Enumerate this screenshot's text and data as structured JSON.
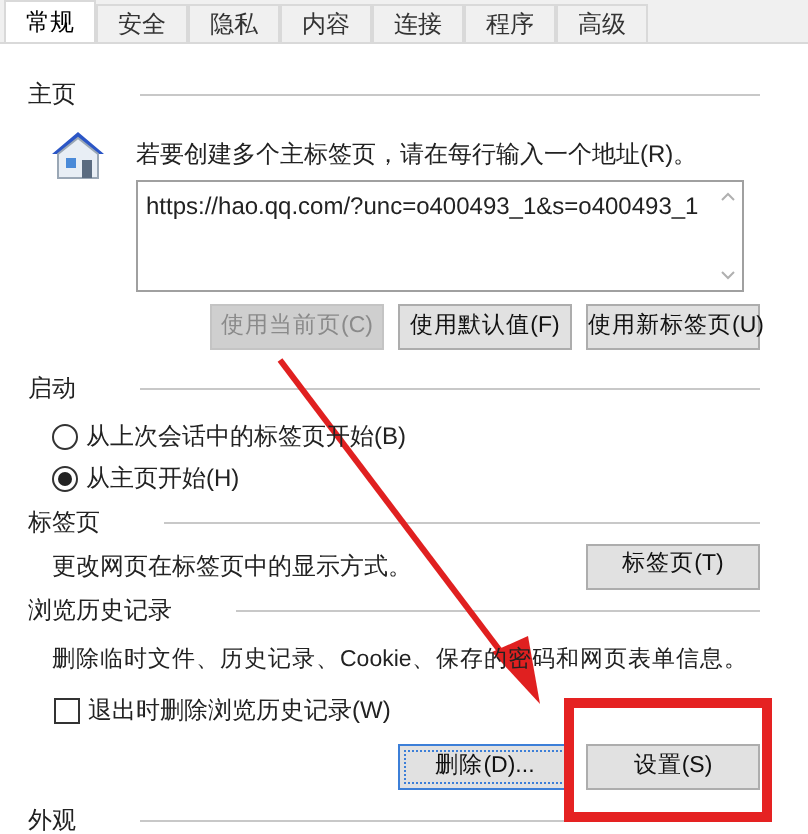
{
  "tabs": [
    {
      "label": "常规",
      "selected": true
    },
    {
      "label": "安全",
      "selected": false
    },
    {
      "label": "隐私",
      "selected": false
    },
    {
      "label": "内容",
      "selected": false
    },
    {
      "label": "连接",
      "selected": false
    },
    {
      "label": "程序",
      "selected": false
    },
    {
      "label": "高级",
      "selected": false
    }
  ],
  "home_page": {
    "title": "主页",
    "hint": "若要创建多个主标签页，请在每行输入一个地址(R)。",
    "url": "https://hao.qq.com/?unc=o400493_1&s=o400493_1",
    "buttons": [
      {
        "label": "使用当前页(C)",
        "disabled": true
      },
      {
        "label": "使用默认值(F)",
        "disabled": false
      },
      {
        "label": "使用新标签页(U)",
        "disabled": false
      }
    ]
  },
  "startup": {
    "title": "启动",
    "options": [
      {
        "label": "从上次会话中的标签页开始(B)",
        "selected": false
      },
      {
        "label": "从主页开始(H)",
        "selected": true
      }
    ]
  },
  "tabs_section": {
    "title": "标签页",
    "description": "更改网页在标签页中的显示方式。",
    "button": "标签页(T)"
  },
  "history": {
    "title": "浏览历史记录",
    "description": "删除临时文件、历史记录、Cookie、保存的密码和网页表单信息。",
    "checkbox": {
      "label": "退出时删除浏览历史记录(W)",
      "checked": false
    },
    "buttons": [
      {
        "label": "删除(D)...",
        "focused": true
      },
      {
        "label": "设置(S)",
        "focused": false
      }
    ]
  },
  "appearance": {
    "title": "外观"
  }
}
